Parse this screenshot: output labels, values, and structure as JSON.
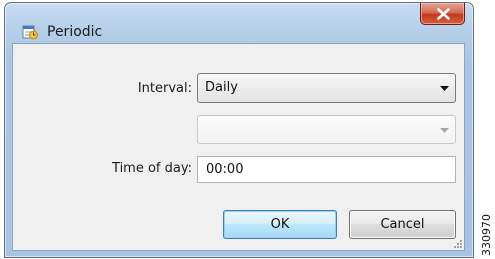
{
  "window": {
    "title": "Periodic",
    "app_icon": "scheduler-icon",
    "close_icon": "close-icon"
  },
  "form": {
    "interval_label": "Interval:",
    "interval_value": "Daily",
    "secondary_value": "",
    "time_of_day_label": "Time of day:",
    "time_of_day_value": "00:00"
  },
  "buttons": {
    "ok_label": "OK",
    "cancel_label": "Cancel"
  },
  "figure_id": "330970",
  "colors": {
    "close_button": "#c2391f",
    "default_button_border": "#3c7fb1",
    "window_frame": "#aac5e3"
  }
}
